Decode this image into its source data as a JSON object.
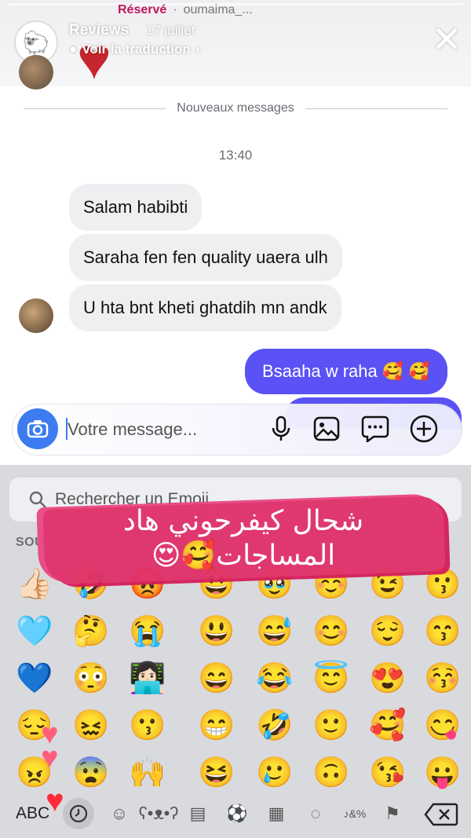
{
  "story": {
    "name": "Reviews",
    "date": "17 juillet",
    "translate": "Voir la traduction",
    "top_strip_status": "Réservé",
    "top_strip_user": "oumaima_..."
  },
  "chat": {
    "divider": "Nouveaux messages",
    "time": "13:40",
    "incoming": [
      "Salam habibti",
      "Saraha fen fen quality uaera ulh",
      "U hta bnt kheti ghatdih mn andk"
    ],
    "outgoing": "Bsaaha w raha 🥰 🥰"
  },
  "composer": {
    "placeholder": "Votre message..."
  },
  "keyboard": {
    "search_placeholder": "Rechercher un Emoji",
    "section_label": "SOU",
    "abc_label": "ABC",
    "emoji_rows": [
      [
        "👍🏻",
        "🤣",
        "😡",
        "😃",
        "🥹",
        "☺️",
        "😉",
        "😗"
      ],
      [
        "🩵",
        "🤔",
        "😭",
        "",
        "😃",
        "😅",
        "😊",
        "😌",
        "😙"
      ],
      [
        "💙",
        "😳",
        "👩🏻‍💻",
        "",
        "😄",
        "😂",
        "😇",
        "😍",
        "😚"
      ],
      [
        "😔",
        "😖",
        "😗",
        "",
        "😁",
        "🤣",
        "🙂",
        "🥰",
        "😋"
      ],
      [
        "😠",
        "😨",
        "🙌",
        "",
        "😆",
        "🥲",
        "🙃",
        "😘",
        "😛"
      ]
    ]
  },
  "overlay": {
    "arabic_line1": "شحال كيفرحوني هاد",
    "arabic_line2": "المساجات🥰😍"
  }
}
